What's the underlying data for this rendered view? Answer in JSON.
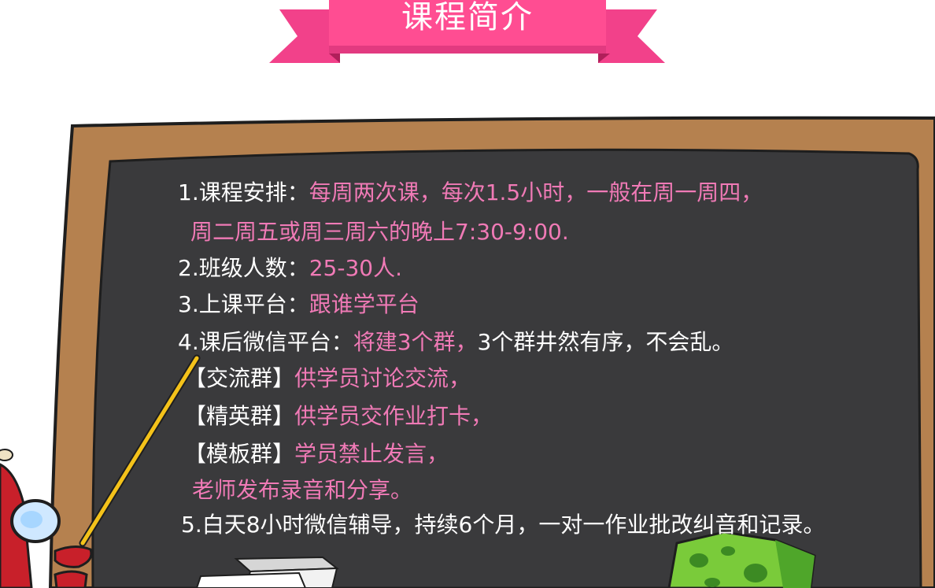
{
  "banner": {
    "title": "课程简介"
  },
  "colors": {
    "banner_pink": "#f2418a",
    "highlight_pink": "#f07ab6",
    "board": "#3a3a3c",
    "frame": "#b5814f"
  },
  "items": {
    "l1_label": "1.课程安排：",
    "l1_value": "每周两次课，每次1.5小时，一般在周一周四，",
    "l2_value": "周二周五或周三周六的晚上7:30-9:00.",
    "l3_label": "2.班级人数：",
    "l3_value": "25-30人.",
    "l4_label": "3.上课平台：",
    "l4_value": "跟谁学平台",
    "l5_label": "4.课后微信平台：",
    "l5_value": "将建3个群，",
    "l5_tail": "3个群井然有序，不会乱。",
    "l6_label": "【交流群】",
    "l6_value": "供学员讨论交流，",
    "l7_label": "【精英群】",
    "l7_value": "供学员交作业打卡，",
    "l8_label": "【模板群】",
    "l8_value": "学员禁止发言，",
    "l9_value": "老师发布录音和分享。",
    "l10": "5.白天8小时微信辅导，持续6个月，一对一作业批改纠音和记录。"
  }
}
